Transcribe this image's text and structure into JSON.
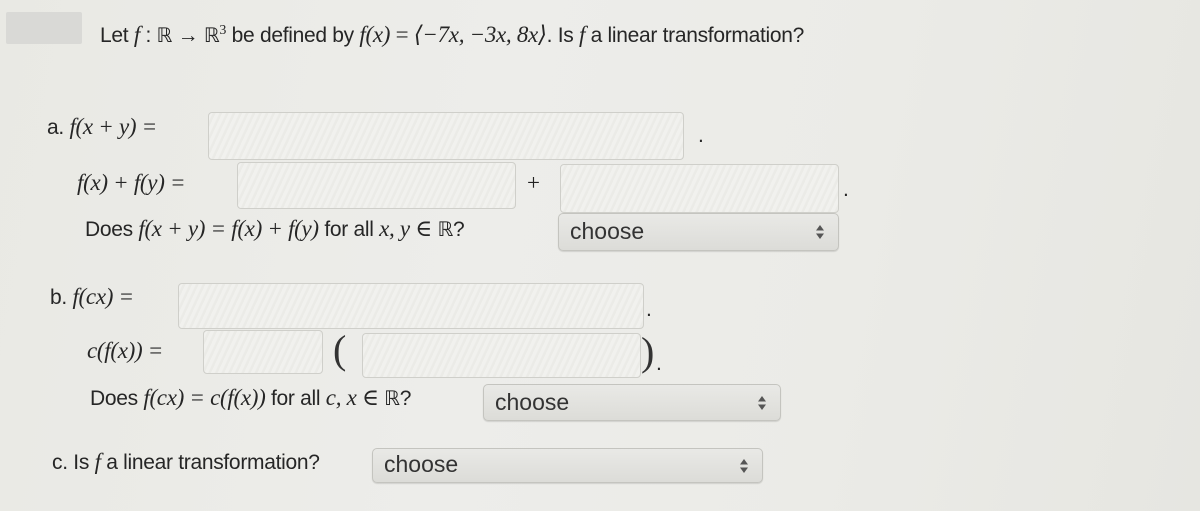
{
  "header": {
    "prefix": "Let",
    "f": "f",
    "colon": " : ",
    "domain": "ℝ",
    "arrow": " → ",
    "codomain": "ℝ",
    "codomain_exp": "3",
    "mid": " be defined by ",
    "fx": "f(x)",
    "eq": " = ",
    "formula": "⟨−7x, −3x, 8x⟩",
    "suffix_dot": ". Is ",
    "f2": "f",
    "suffix": " a linear transformation?"
  },
  "part_a": {
    "label": "a.",
    "lhs1": "f(x + y) =",
    "input1": {
      "value": "",
      "placeholder": ""
    },
    "period1": ".",
    "lhs2": "f(x) + f(y) =",
    "input2": {
      "value": "",
      "placeholder": ""
    },
    "plus": "+",
    "input3": {
      "value": "",
      "placeholder": ""
    },
    "period2": ".",
    "question_prefix": "Does ",
    "question_math": "f(x + y) = f(x) + f(y)",
    "question_mid": " for all ",
    "question_vars": "x, y",
    "question_in": " ∈ ",
    "question_set": "ℝ",
    "question_end": "?",
    "select": {
      "selected": "choose",
      "icon": "up-down-arrows"
    }
  },
  "part_b": {
    "label": "b.",
    "lhs1": "f(cx) =",
    "input1": {
      "value": "",
      "placeholder": ""
    },
    "period1": ".",
    "lhs2": "c(f(x)) =",
    "input2": {
      "value": "",
      "placeholder": ""
    },
    "open_paren": "(",
    "input3": {
      "value": "",
      "placeholder": ""
    },
    "close_paren": ")",
    "period2": ".",
    "question_prefix": "Does ",
    "question_math": "f(cx) = c(f(x))",
    "question_mid": " for all ",
    "question_vars": "c, x",
    "question_in": " ∈ ",
    "question_set": "ℝ",
    "question_end": "?",
    "select": {
      "selected": "choose",
      "icon": "up-down-arrows"
    }
  },
  "part_c": {
    "label": "c.",
    "question_prefix": "Is ",
    "f": "f",
    "question_suffix": " a linear transformation?",
    "select": {
      "selected": "choose",
      "icon": "up-down-arrows"
    }
  }
}
